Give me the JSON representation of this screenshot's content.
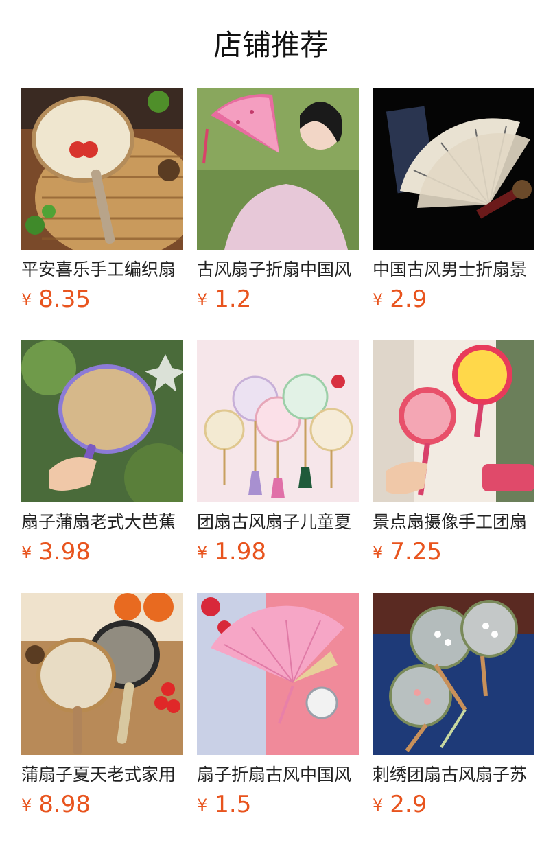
{
  "section": {
    "title": "店铺推荐"
  },
  "products": [
    {
      "name": "平安喜乐手工编织扇",
      "currency": "¥",
      "price": "8.35",
      "image": "woven-round-fan-image"
    },
    {
      "name": "古风扇子折扇中国风",
      "currency": "¥",
      "price": "1.2",
      "image": "pink-folding-fan-model-image"
    },
    {
      "name": "中国古风男士折扇景",
      "currency": "¥",
      "price": "2.9",
      "image": "bamboo-ink-folding-fan-image"
    },
    {
      "name": "扇子蒲扇老式大芭蕉",
      "currency": "¥",
      "price": "3.98",
      "image": "time-to-chill-fan-image"
    },
    {
      "name": "团扇古风扇子儿童夏",
      "currency": "¥",
      "price": "1.98",
      "image": "translucent-round-fans-image"
    },
    {
      "name": "景点扇摄像手工团扇",
      "currency": "¥",
      "price": "7.25",
      "image": "photo-prop-fans-image"
    },
    {
      "name": "蒲扇子夏天老式家用",
      "currency": "¥",
      "price": "8.98",
      "image": "rattan-fans-image"
    },
    {
      "name": "扇子折扇古风中国风",
      "currency": "¥",
      "price": "1.5",
      "image": "plum-blossom-folding-fan-image"
    },
    {
      "name": "刺绣团扇古风扇子苏",
      "currency": "¥",
      "price": "2.9",
      "image": "embroidered-round-fans-image"
    }
  ],
  "colors": {
    "price": "#e8541e",
    "text": "#222222",
    "background": "#ffffff"
  }
}
